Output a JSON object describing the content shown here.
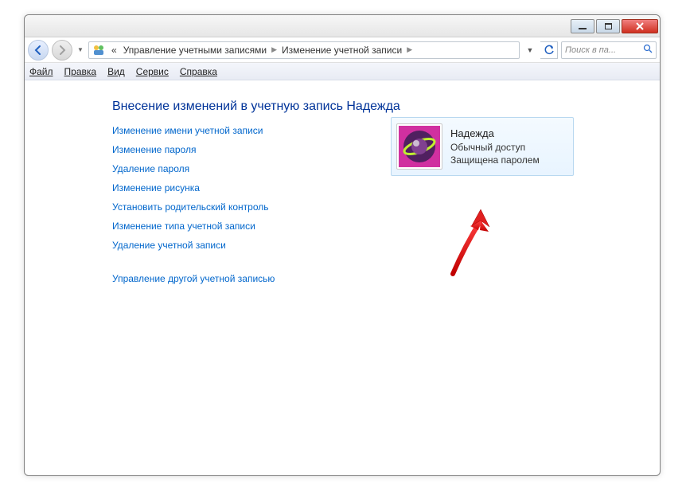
{
  "titlebar": {},
  "breadcrumbs": {
    "prefix": "«",
    "item1": "Управление учетными записями",
    "item2": "Изменение учетной записи"
  },
  "search": {
    "placeholder": "Поиск в па..."
  },
  "menu": {
    "file": "Файл",
    "edit": "Правка",
    "view": "Вид",
    "tools": "Сервис",
    "help": "Справка"
  },
  "heading": "Внесение изменений в учетную запись Надежда",
  "tasks": {
    "change_name": "Изменение имени учетной записи",
    "change_password": "Изменение пароля",
    "remove_password": "Удаление пароля",
    "change_picture": "Изменение рисунка",
    "parental_controls": "Установить родительский контроль",
    "change_type": "Изменение типа учетной записи",
    "delete_account": "Удаление учетной записи",
    "manage_other": "Управление другой учетной записью"
  },
  "user": {
    "name": "Надежда",
    "type": "Обычный доступ",
    "status": "Защищена паролем"
  }
}
